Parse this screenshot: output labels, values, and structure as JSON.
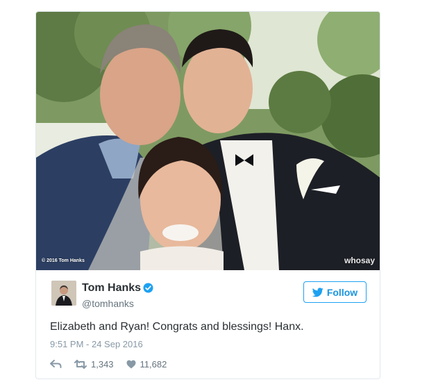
{
  "photo": {
    "copyright": "© 2016 Tom Hanks",
    "watermark": "whosay"
  },
  "author": {
    "name": "Tom Hanks",
    "handle": "@tomhanks",
    "verified": true
  },
  "follow_button": {
    "label": "Follow",
    "icon": "twitter-bird-icon"
  },
  "tweet": {
    "text": "Elizabeth and Ryan! Congrats and blessings! Hanx.",
    "timestamp": "9:51 PM - 24 Sep 2016"
  },
  "actions": {
    "reply_icon": "reply-icon",
    "retweet_icon": "retweet-icon",
    "retweet_count": "1,343",
    "like_icon": "heart-icon",
    "like_count": "11,682"
  },
  "colors": {
    "accent": "#1da1f2",
    "text": "#292f33",
    "muted": "#8899a6"
  }
}
